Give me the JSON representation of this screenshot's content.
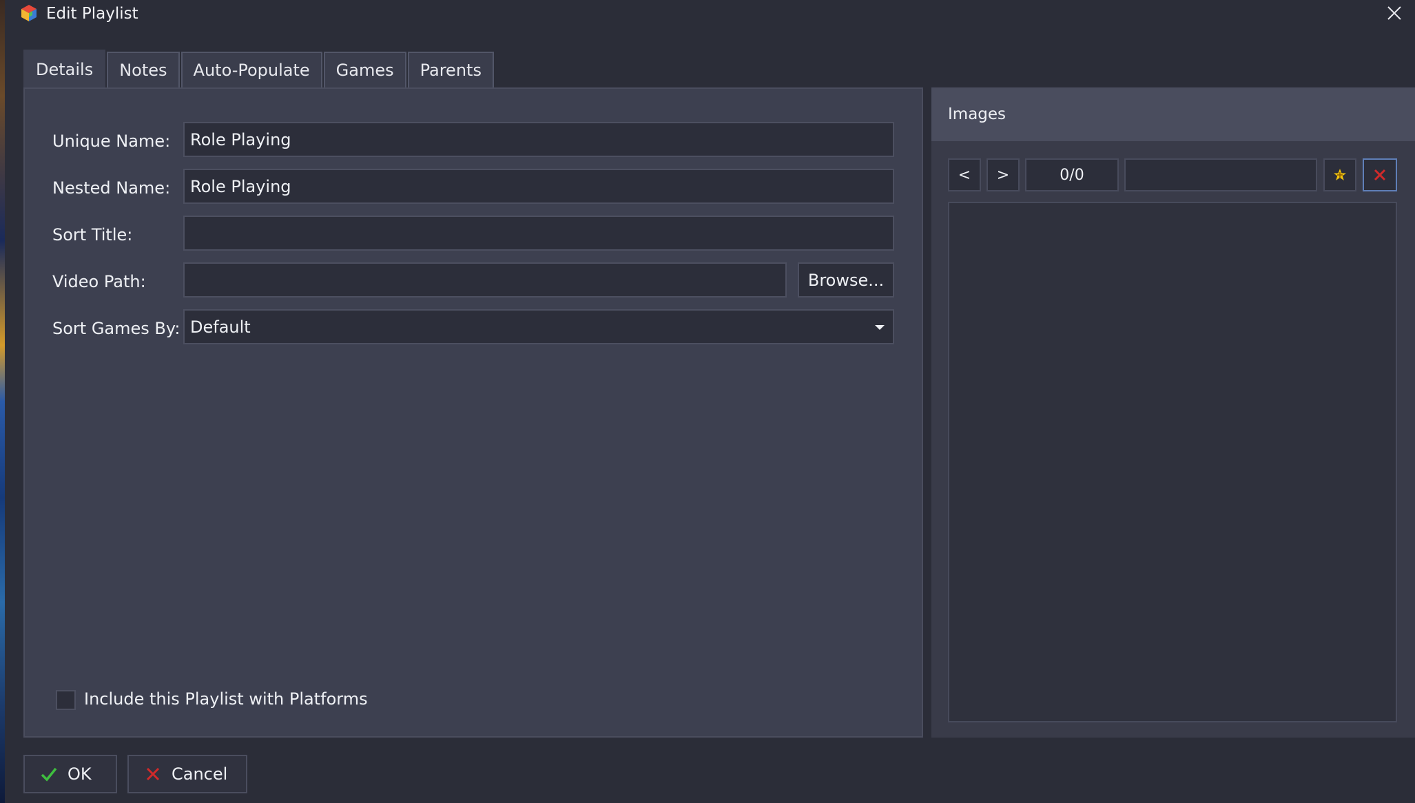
{
  "window": {
    "title": "Edit Playlist"
  },
  "tabs": [
    {
      "label": "Details",
      "active": true
    },
    {
      "label": "Notes",
      "active": false
    },
    {
      "label": "Auto-Populate",
      "active": false
    },
    {
      "label": "Games",
      "active": false
    },
    {
      "label": "Parents",
      "active": false
    }
  ],
  "details": {
    "unique_name_label": "Unique Name:",
    "unique_name_value": "Role Playing",
    "nested_name_label": "Nested Name:",
    "nested_name_value": "Role Playing",
    "sort_title_label": "Sort Title:",
    "sort_title_value": "",
    "video_path_label": "Video Path:",
    "video_path_value": "",
    "browse_label": "Browse...",
    "sort_games_by_label": "Sort Games By:",
    "sort_games_by_value": "Default",
    "include_platforms_label": "Include this Playlist with Platforms",
    "include_platforms_checked": false
  },
  "images": {
    "title": "Images",
    "prev_label": "<",
    "next_label": ">",
    "counter": "0/0",
    "type_value": ""
  },
  "footer": {
    "ok_label": "OK",
    "cancel_label": "Cancel"
  },
  "colors": {
    "background": "#2b2d38",
    "panel": "#3d4050",
    "field": "#2c2e3a",
    "ok_check": "#3fbf3f",
    "cancel_x": "#d12a2a",
    "add_star": "#f1c40f"
  }
}
